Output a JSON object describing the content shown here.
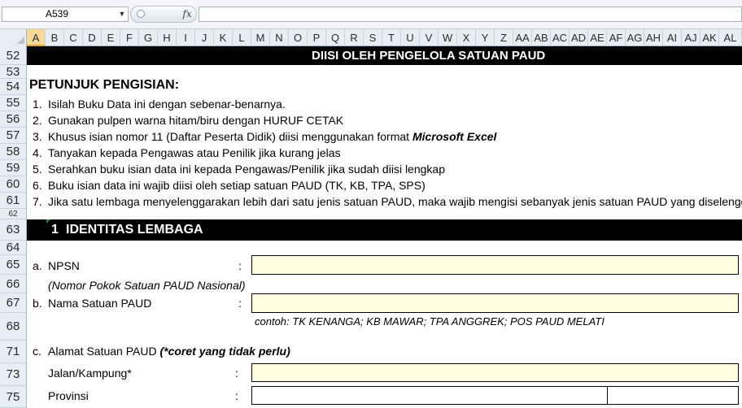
{
  "formula_bar": {
    "name_box": "A539",
    "fx_label": "fx",
    "formula": ""
  },
  "columns": [
    "A",
    "B",
    "C",
    "D",
    "E",
    "F",
    "G",
    "H",
    "I",
    "J",
    "K",
    "L",
    "M",
    "N",
    "O",
    "P",
    "Q",
    "R",
    "S",
    "T",
    "U",
    "V",
    "W",
    "X",
    "Y",
    "Z",
    "AA",
    "AB",
    "AC",
    "AD",
    "AE",
    "AF",
    "AG",
    "AH",
    "AI",
    "AJ",
    "AK",
    "AL"
  ],
  "selected_column": "A",
  "rows": [
    "52",
    "53",
    "54",
    "55",
    "56",
    "57",
    "58",
    "59",
    "60",
    "61",
    "62",
    "63",
    "64",
    "65",
    "66",
    "67",
    "68",
    "71",
    "73",
    "75"
  ],
  "sheet": {
    "header_title": "DIISI OLEH PENGELOLA SATUAN PAUD",
    "instructions_title": "PETUNJUK PENGISIAN:",
    "instructions": [
      {
        "num": "1.",
        "text": "Isilah Buku Data ini dengan sebenar-benarnya."
      },
      {
        "num": "2.",
        "text": "Gunakan pulpen warna hitam/biru dengan HURUF CETAK"
      },
      {
        "num": "3.",
        "text": "Khusus isian nomor 11 (Daftar Peserta Didik) diisi menggunakan format ",
        "emph": "Microsoft Excel"
      },
      {
        "num": "4.",
        "text": "Tanyakan kepada Pengawas atau Penilik jika kurang jelas"
      },
      {
        "num": "5.",
        "text": "Serahkan buku isian data ini kepada Pengawas/Penilik jika sudah diisi lengkap"
      },
      {
        "num": "6.",
        "text": "Buku isian data ini wajib diisi oleh setiap satuan PAUD (TK, KB, TPA, SPS)"
      },
      {
        "num": "7.",
        "text": "Jika satu lembaga menyelenggarakan lebih dari satu jenis satuan PAUD, maka wajib mengisi sebanyak jenis satuan PAUD yang diselenggarakan"
      }
    ],
    "section_number": "1",
    "section_title": "IDENTITAS LEMBAGA",
    "fields": {
      "npsn": {
        "letter": "a.",
        "label": "NPSN",
        "sublabel": "(Nomor Pokok Satuan PAUD Nasional)",
        "colon": ":",
        "value": ""
      },
      "nama": {
        "letter": "b.",
        "label": "Nama Satuan PAUD",
        "colon": ":",
        "value": "",
        "example": "contoh: TK KENANGA; KB MAWAR; TPA ANGGREK; POS PAUD MELATI"
      },
      "alamat": {
        "letter": "c.",
        "label": "Alamat Satuan PAUD",
        "note": "(*coret yang tidak perlu)"
      },
      "jalan": {
        "label": "Jalan/Kampung*",
        "colon": ":",
        "value": ""
      },
      "provinsi": {
        "label": "Provinsi",
        "colon": ":",
        "value": ""
      }
    }
  }
}
